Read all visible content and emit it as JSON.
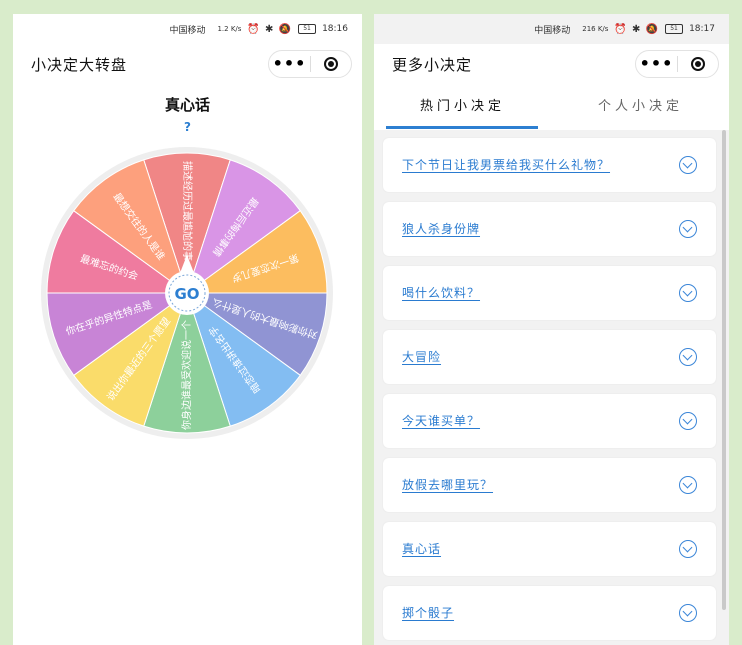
{
  "left": {
    "status": {
      "carrier": "中国移动",
      "speed": "1.2 K/s",
      "time": "18:16",
      "battery": "51"
    },
    "nav": {
      "title": "小决定大转盘"
    },
    "wheel": {
      "title": "真心话",
      "help": "?",
      "go_label": "GO",
      "segments": [
        {
          "text": "描述经历过最尴尬的事",
          "color": "#f08686"
        },
        {
          "text": "最近后悔的事情",
          "color": "#d995e6"
        },
        {
          "text": "第一次恋爱几岁",
          "color": "#fcbd5f"
        },
        {
          "text": "对你影响最大的人是什么",
          "color": "#9094d3"
        },
        {
          "text": "暗恋过谁讲出名字",
          "color": "#83bdf2"
        },
        {
          "text": "你身边谁最受欢迎说一个",
          "color": "#8dd09b"
        },
        {
          "text": "说出你最近的三个愿望",
          "color": "#fadc6a"
        },
        {
          "text": "你在乎的异性特点是",
          "color": "#c884d6"
        },
        {
          "text": "最难忘的约会",
          "color": "#ef7b9f"
        },
        {
          "text": "最想交往的人是谁",
          "color": "#fda07d"
        }
      ]
    }
  },
  "right": {
    "status": {
      "carrier": "中国移动",
      "speed": "216 K/s",
      "time": "18:17",
      "battery": "51"
    },
    "nav": {
      "title": "更多小决定"
    },
    "tabs": [
      {
        "label": "热门小决定"
      },
      {
        "label": "个人小决定"
      }
    ],
    "items": [
      {
        "label": "下个节日让我男票给我买什么礼物？"
      },
      {
        "label": "狼人杀身份牌"
      },
      {
        "label": "喝什么饮料？"
      },
      {
        "label": "大冒险"
      },
      {
        "label": "今天谁买单？"
      },
      {
        "label": "放假去哪里玩？"
      },
      {
        "label": "真心话"
      },
      {
        "label": "掷个骰子"
      }
    ]
  }
}
